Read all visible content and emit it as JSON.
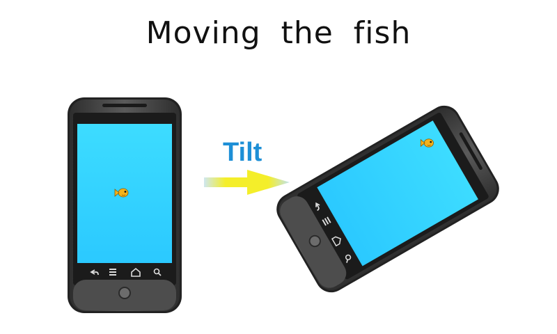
{
  "title": "Moving the fish",
  "arrow": {
    "label": "Tilt",
    "label_color": "#1d8fd6",
    "fill_color": "#f2ea1b",
    "edge_color": "#9ccfe6"
  },
  "phones": {
    "body_color": "#3c3c3c",
    "screen_color": "#33d6ff",
    "upright": {
      "nav_icons": [
        "back-icon",
        "menu-icon",
        "home-icon",
        "search-icon"
      ]
    },
    "tilted": {
      "nav_icons": [
        "back-icon",
        "menu-icon",
        "home-icon",
        "search-icon"
      ]
    }
  }
}
